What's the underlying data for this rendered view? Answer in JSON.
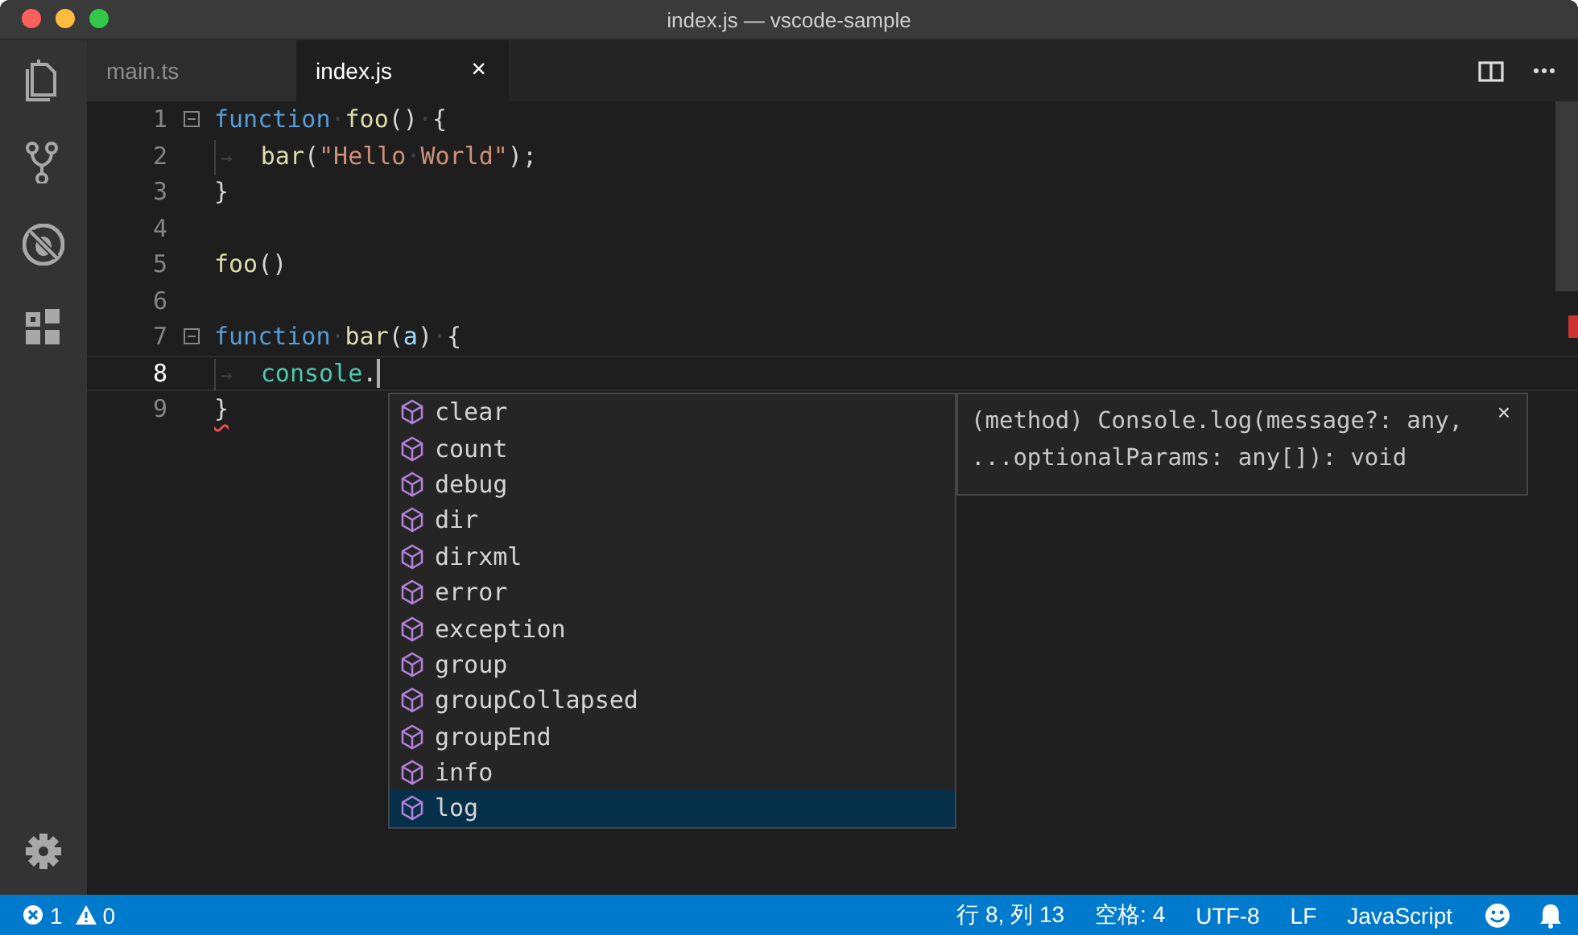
{
  "window": {
    "title": "index.js — vscode-sample"
  },
  "tabs": [
    {
      "label": "main.ts",
      "selected": false
    },
    {
      "label": "index.js",
      "selected": true,
      "close": "×"
    }
  ],
  "editor": {
    "lines": [
      {
        "number": "1",
        "foldable": true,
        "current": false,
        "tokens": [
          {
            "kind": "kw",
            "text": "function"
          },
          {
            "kind": "ws",
            "text": "·"
          },
          {
            "kind": "fn",
            "text": "foo"
          },
          {
            "kind": "punc",
            "text": "()"
          },
          {
            "kind": "ws",
            "text": "·"
          },
          {
            "kind": "punc",
            "text": "{"
          }
        ]
      },
      {
        "number": "2",
        "foldable": false,
        "current": false,
        "tokens": [
          {
            "kind": "tab",
            "text": "→"
          },
          {
            "kind": "fn",
            "text": "bar"
          },
          {
            "kind": "punc",
            "text": "("
          },
          {
            "kind": "str",
            "text": "\"Hello"
          },
          {
            "kind": "ws",
            "text": "·"
          },
          {
            "kind": "str",
            "text": "World\""
          },
          {
            "kind": "punc",
            "text": ");"
          }
        ]
      },
      {
        "number": "3",
        "foldable": false,
        "current": false,
        "tokens": [
          {
            "kind": "punc",
            "text": "}"
          }
        ]
      },
      {
        "number": "4",
        "foldable": false,
        "current": false
      },
      {
        "number": "5",
        "foldable": false,
        "current": false,
        "tokens": [
          {
            "kind": "fn",
            "text": "foo"
          },
          {
            "kind": "punc",
            "text": "()"
          }
        ]
      },
      {
        "number": "6",
        "foldable": false,
        "current": false
      },
      {
        "number": "7",
        "foldable": true,
        "current": false,
        "tokens": [
          {
            "kind": "kw",
            "text": "function"
          },
          {
            "kind": "ws",
            "text": "·"
          },
          {
            "kind": "fn",
            "text": "bar"
          },
          {
            "kind": "punc",
            "text": "("
          },
          {
            "kind": "var",
            "text": "a"
          },
          {
            "kind": "punc",
            "text": ")"
          },
          {
            "kind": "ws",
            "text": "·"
          },
          {
            "kind": "punc",
            "text": "{"
          }
        ]
      },
      {
        "number": "8",
        "foldable": false,
        "current": true,
        "tokens": [
          {
            "kind": "tab",
            "text": "→"
          },
          {
            "kind": "type",
            "text": "console"
          },
          {
            "kind": "punc",
            "text": "."
          }
        ]
      },
      {
        "number": "9",
        "foldable": false,
        "current": false,
        "tokens": [
          {
            "kind": "punc",
            "text": "}",
            "error": true
          }
        ]
      }
    ]
  },
  "suggest": {
    "items": [
      {
        "label": "clear",
        "selected": false
      },
      {
        "label": "count",
        "selected": false
      },
      {
        "label": "debug",
        "selected": false
      },
      {
        "label": "dir",
        "selected": false
      },
      {
        "label": "dirxml",
        "selected": false
      },
      {
        "label": "error",
        "selected": false
      },
      {
        "label": "exception",
        "selected": false
      },
      {
        "label": "group",
        "selected": false
      },
      {
        "label": "groupCollapsed",
        "selected": false
      },
      {
        "label": "groupEnd",
        "selected": false
      },
      {
        "label": "info",
        "selected": false
      },
      {
        "label": "log",
        "selected": true
      }
    ],
    "details": {
      "signature_lines": [
        "(method) Console.log(message?: any,",
        "...optionalParams: any[]): void"
      ],
      "close": "×"
    }
  },
  "status_bar": {
    "errors": "1",
    "warnings": "0",
    "items": [
      "行 8, 列 13",
      "空格: 4",
      "UTF-8",
      "LF",
      "JavaScript"
    ]
  }
}
